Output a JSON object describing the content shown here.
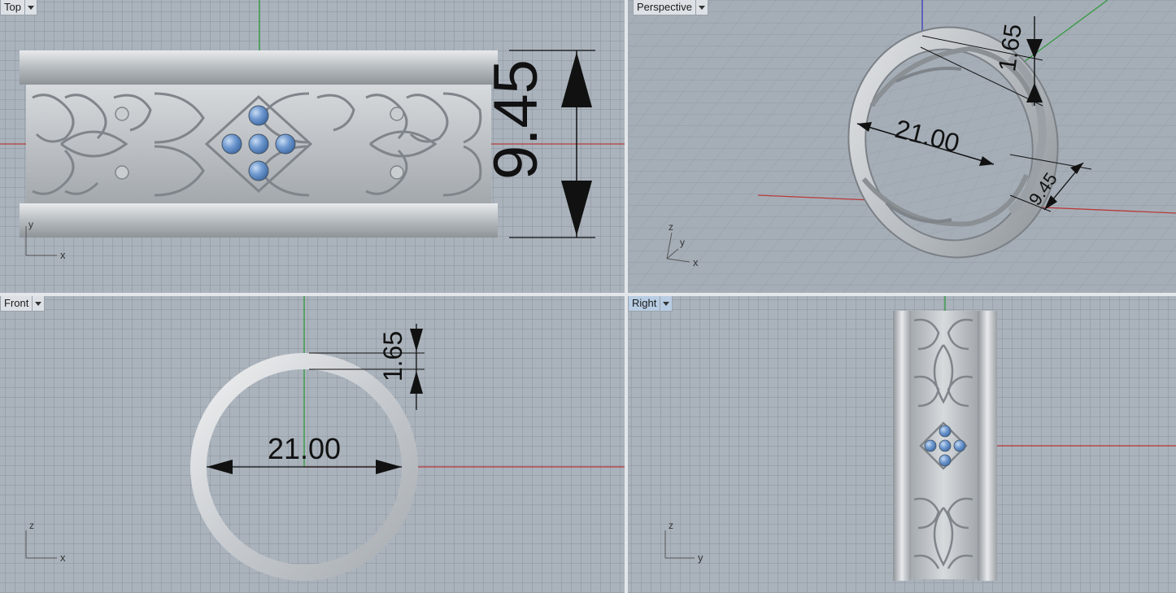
{
  "viewports": {
    "top": {
      "title": "Top"
    },
    "perspective": {
      "title": "Perspective"
    },
    "front": {
      "title": "Front"
    },
    "right": {
      "title": "Right"
    }
  },
  "dimensions": {
    "width": "9.45",
    "thickness": "1.65",
    "inner_diameter": "21.00"
  },
  "axis_labels": {
    "x": "x",
    "y": "y",
    "z": "z"
  },
  "colors": {
    "viewport_bg": "#aab3bc",
    "x_axis": "#b83a3a",
    "y_axis": "#2f9a3a",
    "z_axis": "#3a3ab8",
    "metal": "#c9cdd0",
    "gem": "#6e98cf",
    "active_label": "#b8cde3"
  }
}
